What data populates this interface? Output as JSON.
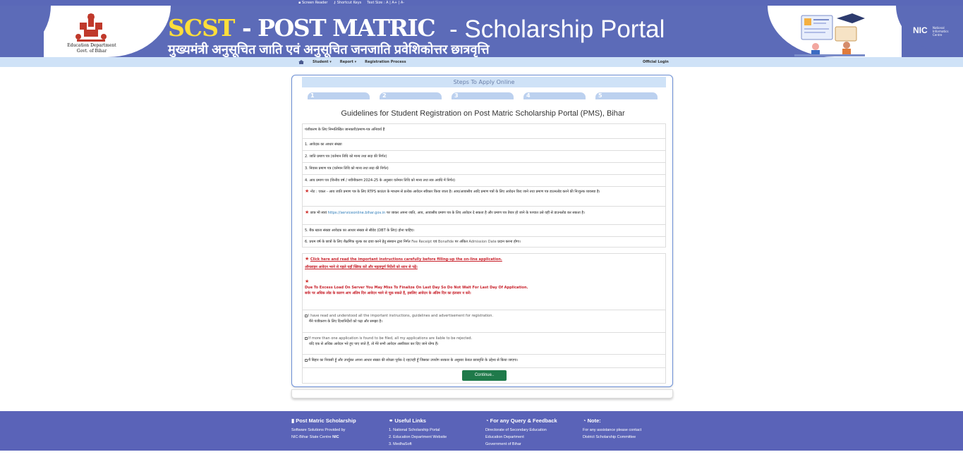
{
  "topbar": {
    "screen_reader": "Screen Reader",
    "shortcut_keys": "Shortcut Keys",
    "text_size": "Text Size : A | A+ | A-"
  },
  "header": {
    "dept_line1": "Education Department",
    "dept_line2": "Govt. of Bihar",
    "title_scst": "SCST",
    "title_pm": "- POST MATRIC",
    "title_sp": "- Scholarship Portal",
    "title_hindi": "मुख्यमंत्री अनुसूचित जाति एवं अनुसूचित जनजाति  प्रवेशिकोत्तर छात्रवृत्ति",
    "nic_logo": "NIC",
    "nic_sub": "National Informatics Centre"
  },
  "nav": {
    "student": "Student",
    "report": "Report",
    "registration": "Registration Process",
    "login": "Official Login"
  },
  "card": {
    "steps_head": "Steps To Apply Online",
    "steps": [
      "1",
      "2",
      "3",
      "4",
      "5"
    ],
    "guide_title": "Guidelines for Student Registration on Post Matric Scholarship Portal (PMS), Bihar",
    "rows": {
      "r0": "पंजीकरण के लिए निम्नलिखित जानकारी/प्रमाण-पत्र अनिवार्य हैं",
      "r1": "1. आवेदक का आधार संख्या",
      "r2": "2. जाति प्रमाण पत्र (वर्तमान तिथि को मान्य तथा सदा की निर्गत)",
      "r3": "3. निवास प्रमाण पत्र (वर्तमान तिथि को मान्य तथा सदा की निर्गत)",
      "r4": "4. आय प्रमाण पत्र (वित्तीय वर्ष / नवीनीकरण 2024-25 के अनुसार वर्तमान तिथि को मान्य तथा सत्र अवधि में निर्गत)",
      "r5": "नोट : एकल - आय जाति प्रमाण पत्र के लिए RTPS काउंटर के माध्यम से प्रत्येक आवेदन स्वीकार किया जाता है। आय/आवासीय आदि प्रमाण पत्रों के लिए आवेदन किए जाने तथा प्रमाण पत्र डाउनलोड करने की निःशुल्क व्यवस्था है।",
      "r6a": "छात्र भी स्वयं",
      "r6link": "https://serviceonline.bihar.gov.in",
      "r6b": "पर जाकर अपना जाति, आय, आवासीय प्रमाण पत्र के लिए आवेदन दे सकता है और प्रमाण पत्र तैयार हो जाने के पश्चात उसे वहीं से डाउनलोड कर सकता है।",
      "r7": "5. बैंक खाता संख्या आवेदक का आधार संख्या से सीडेड (DBT के लिए) होना चाहिए।",
      "r8a": "6. प्रथम वर्ष के छात्रों के लिए शैक्षणिक शुल्क का दावा करने हेतु संस्थान द्वारा निर्गत",
      "r8b": "Fee Receipt",
      "r8c": "एवं",
      "r8d": "Bonafide",
      "r8e": "पर अंकित",
      "r8f": "Admission Date",
      "r8g": "प्रदान करना होगा।"
    },
    "notice": {
      "link": "Click here and read the important instructions carefully before filling-up the on-line application.",
      "hindi1": "ऑनलाइन आवेदन भरने से पहले यहाँ क्लिक करें और महत्वपूर्ण निर्देशों को ध्यान से पढ़ें।",
      "en2": "Due To Excess Load On Server You May Miss To Finalize On Last Day So Do Not Wait For Last Day Of Application.",
      "hindi2": "सर्वर पर अधिक लोड के कारण आप अंतिम दिन आवेदन भरने से चूक सकते हैं, इसलिए आवेदन के अंतिम दिन का इंतजार न करें।"
    },
    "checks": {
      "c1en": "I have read and understood all the important instructions, guidelines and advertisement for registration.",
      "c1hi": "मैंने पंजीकरण के लिए दिशानिर्देशों को पढ़ा और समझा है।",
      "c2en": "If more than one application is found to be filed, all my applications are liable to be rejected.",
      "c2hi": "यदि एक से अधिक आवेदन भरे हुए पाए जाते हैं, तो मेरे सभी आवेदन अस्वीकार कर दिए जाने योग्य हैं।",
      "c3hi": "मैं बिहार का निवासी हूँ और उपर्युक्त अपना आधार संख्या की स्वेच्छा पूर्वक दे रहा/रही हूँ जिसका उपयोग सरकार के अनुसार केवल छात्रवृत्ति के उद्देश्य से किया जाएगा।"
    },
    "continue_btn": "Continue.."
  },
  "footer": {
    "col1_head": "Post Matric Scholarship",
    "col1_l1": "Software Solutions Provided by",
    "col1_l2": "NIC-Bihar State Centre",
    "col2_head": "Useful Links",
    "col2_l1": "1. National Scholarship Portal",
    "col2_l2": "2. Education Department Website",
    "col2_l3": "3. MedhaSoft",
    "col3_head": "For any Query & Feedback",
    "col3_l1": "Directorate of Secondary Education",
    "col3_l2": "Education Department",
    "col3_l3": "Government of Bihar",
    "col4_head": "Note:",
    "col4_l1": "For any assistance please contact",
    "col4_l2": "District Scholarship Committee"
  },
  "colors": {
    "header_bg": "#5c6bb8",
    "accent_yellow": "#ffde3a",
    "nav_bg": "#cfe2f7",
    "button_green": "#1f7a4a",
    "notice_red": "#c8202a"
  }
}
